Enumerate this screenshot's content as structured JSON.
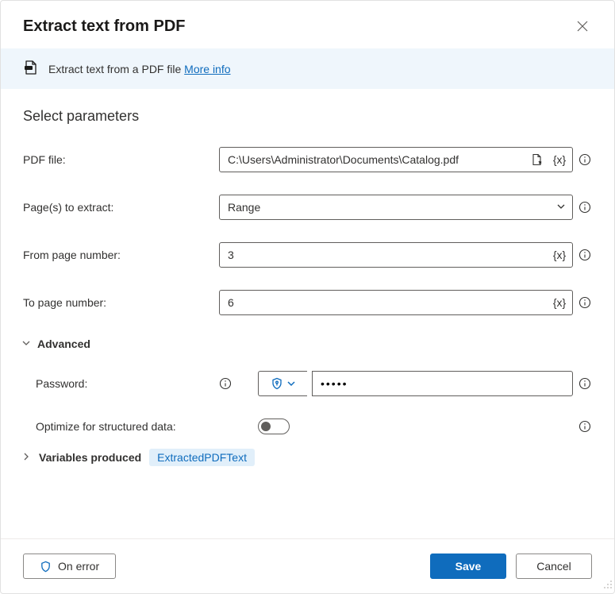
{
  "title": "Extract text from PDF",
  "banner": {
    "text": "Extract text from a PDF file ",
    "link": "More info"
  },
  "sectionTitle": "Select parameters",
  "fields": {
    "pdfFile": {
      "label": "PDF file:",
      "value": "C:\\Users\\Administrator\\Documents\\Catalog.pdf"
    },
    "pages": {
      "label": "Page(s) to extract:",
      "value": "Range"
    },
    "fromPage": {
      "label": "From page number:",
      "value": "3"
    },
    "toPage": {
      "label": "To page number:",
      "value": "6"
    },
    "password": {
      "label": "Password:",
      "value": "•••••"
    },
    "optimize": {
      "label": "Optimize for structured data:",
      "value": false
    }
  },
  "advancedLabel": "Advanced",
  "variablesProduced": {
    "label": "Variables produced",
    "pills": [
      "ExtractedPDFText"
    ]
  },
  "varToken": "{x}",
  "footer": {
    "onError": "On error",
    "save": "Save",
    "cancel": "Cancel"
  }
}
